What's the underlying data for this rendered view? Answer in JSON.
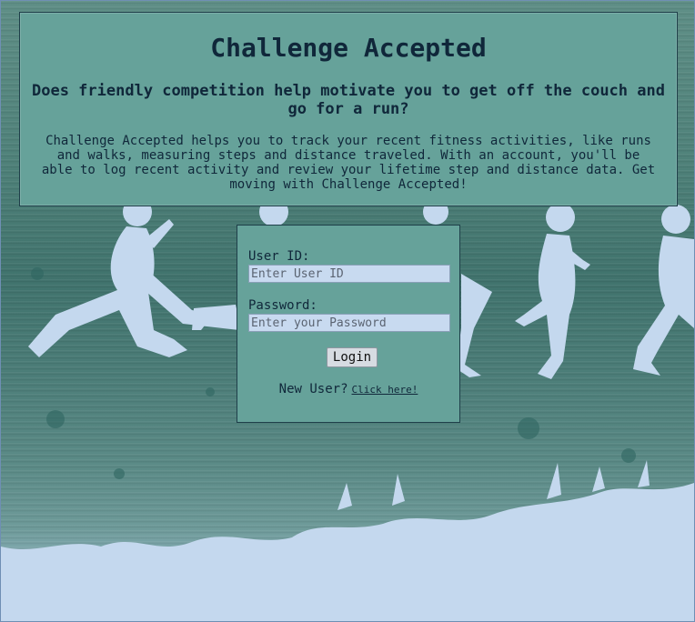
{
  "intro": {
    "title": "Challenge Accepted",
    "question": "Does friendly competition help motivate you to get off the couch and go for a run?",
    "description": "Challenge Accepted helps you to track your recent fitness activities, like runs and walks, measuring steps and distance traveled. With an account, you'll be able to log recent activity and review your lifetime step and distance data. Get moving with Challenge Accepted!"
  },
  "login": {
    "user_id_label": "User ID:",
    "user_id_placeholder": "Enter User ID",
    "password_label": "Password:",
    "password_placeholder": "Enter your Password",
    "login_button": "Login",
    "new_user_text": "New User?",
    "click_here_link": "Click here!"
  },
  "colors": {
    "panel": "#66a29a",
    "panel_border": "#1f3f4a",
    "text": "#10273a",
    "runner": "#c4d8ee"
  }
}
